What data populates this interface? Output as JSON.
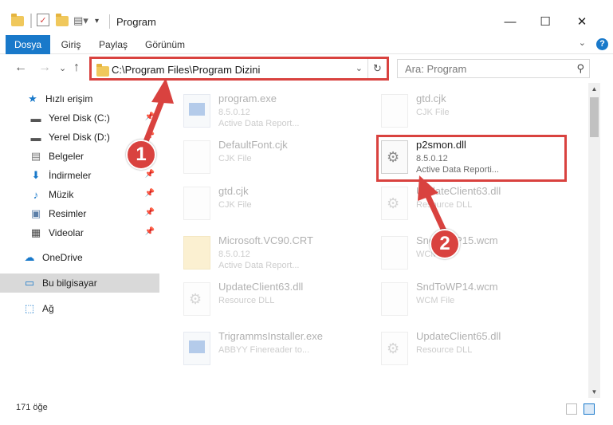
{
  "window": {
    "title": "Program",
    "minimize": "—",
    "maximize": "☐",
    "close": "✕"
  },
  "ribbon": {
    "tabs": [
      "Dosya",
      "Giriş",
      "Paylaş",
      "Görünüm"
    ],
    "active_tab": "Dosya",
    "help": "?",
    "chevron": "⌄"
  },
  "nav": {
    "back": "←",
    "forward": "→",
    "recent": "⌄",
    "up": "↑",
    "address": "C:\\Program Files\\Program Dizini",
    "address_dropdown": "⌄",
    "refresh": "↻",
    "search_placeholder": "Ara: Program",
    "search_icon": "⚲"
  },
  "sidebar": {
    "items": [
      {
        "label": "Hızlı erişim",
        "icon": "star-icon",
        "glyph": "★",
        "color": "#1979ca",
        "pinned": false
      },
      {
        "label": "Yerel Disk (C:)",
        "icon": "drive-icon",
        "glyph": "▬",
        "color": "#555555",
        "pinned": true
      },
      {
        "label": "Yerel Disk (D:)",
        "icon": "drive-icon",
        "glyph": "▬",
        "color": "#555555",
        "pinned": true
      },
      {
        "label": "Belgeler",
        "icon": "documents-icon",
        "glyph": "▤",
        "color": "#777777",
        "pinned": true
      },
      {
        "label": "İndirmeler",
        "icon": "downloads-icon",
        "glyph": "⬇",
        "color": "#1979ca",
        "pinned": true
      },
      {
        "label": "Müzik",
        "icon": "music-icon",
        "glyph": "♪",
        "color": "#1979ca",
        "pinned": true
      },
      {
        "label": "Resimler",
        "icon": "pictures-icon",
        "glyph": "▣",
        "color": "#5b7fa8",
        "pinned": true
      },
      {
        "label": "Videolar",
        "icon": "videos-icon",
        "glyph": "▦",
        "color": "#444444",
        "pinned": true
      },
      {
        "label": "OneDrive",
        "icon": "onedrive-icon",
        "glyph": "☁",
        "color": "#1979ca",
        "pinned": false
      },
      {
        "label": "Bu bilgisayar",
        "icon": "computer-icon",
        "glyph": "▭",
        "color": "#1979ca",
        "pinned": false,
        "selected": true
      },
      {
        "label": "Ağ",
        "icon": "network-icon",
        "glyph": "⬚",
        "color": "#1979ca",
        "pinned": false
      }
    ],
    "pin_glyph": "📌"
  },
  "files": [
    {
      "name": "program.exe",
      "line1": "8.5.0.12",
      "line2": "Active Data Report...",
      "type": "exe",
      "faded": true
    },
    {
      "name": "gtd.cjk",
      "line1": "CJK File",
      "line2": "",
      "type": "doc",
      "faded": true
    },
    {
      "name": "DefaultFont.cjk",
      "line1": "CJK File",
      "line2": "",
      "type": "doc",
      "faded": true
    },
    {
      "name": "p2smon.dll",
      "line1": "8.5.0.12",
      "line2": "Active Data Reporti...",
      "type": "dll",
      "faded": false
    },
    {
      "name": "gtd.cjk",
      "line1": "CJK File",
      "line2": "",
      "type": "doc",
      "faded": true
    },
    {
      "name": "UpdateClient63.dll",
      "line1": "Resource DLL",
      "line2": "",
      "type": "dll",
      "faded": true
    },
    {
      "name": "Microsoft.VC90.CRT",
      "line1": "8.5.0.12",
      "line2": "Active Data Report...",
      "type": "fold",
      "faded": true
    },
    {
      "name": "SndToWP15.wcm",
      "line1": "WCM File",
      "line2": "",
      "type": "doc",
      "faded": true
    },
    {
      "name": "UpdateClient63.dll",
      "line1": "Resource DLL",
      "line2": "",
      "type": "dll",
      "faded": true
    },
    {
      "name": "SndToWP14.wcm",
      "line1": "WCM File",
      "line2": "",
      "type": "doc",
      "faded": true
    },
    {
      "name": "TrigrammsInstaller.exe",
      "line1": "ABBYY Finereader to...",
      "line2": "",
      "type": "exe",
      "faded": true
    },
    {
      "name": "UpdateClient65.dll",
      "line1": "Resource DLL",
      "line2": "",
      "type": "dll",
      "faded": true
    }
  ],
  "status": {
    "count": "171 öğe"
  },
  "annotations": {
    "badge1": "1",
    "badge2": "2",
    "color": "#d9423f"
  }
}
